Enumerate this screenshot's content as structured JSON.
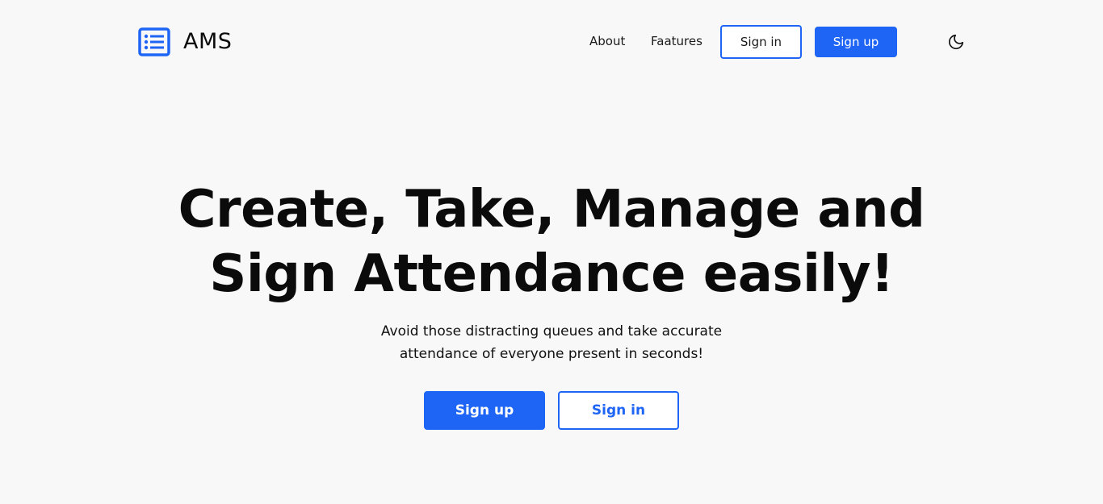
{
  "brand": {
    "name": "AMS",
    "icon": "list-icon",
    "accent_color": "#1f65f5"
  },
  "nav": {
    "about_label": "About",
    "features_label": "Faatures",
    "signin_label": "Sign in",
    "signup_label": "Sign up",
    "theme_toggle_icon": "moon-icon"
  },
  "hero": {
    "title_line1": "Create, Take, Manage and",
    "title_line2": "Sign Attendance easily!",
    "subtitle_line1": "Avoid those distracting queues and take accurate",
    "subtitle_line2": "attendance of everyone present in seconds!",
    "signup_label": "Sign up",
    "signin_label": "Sign in"
  }
}
